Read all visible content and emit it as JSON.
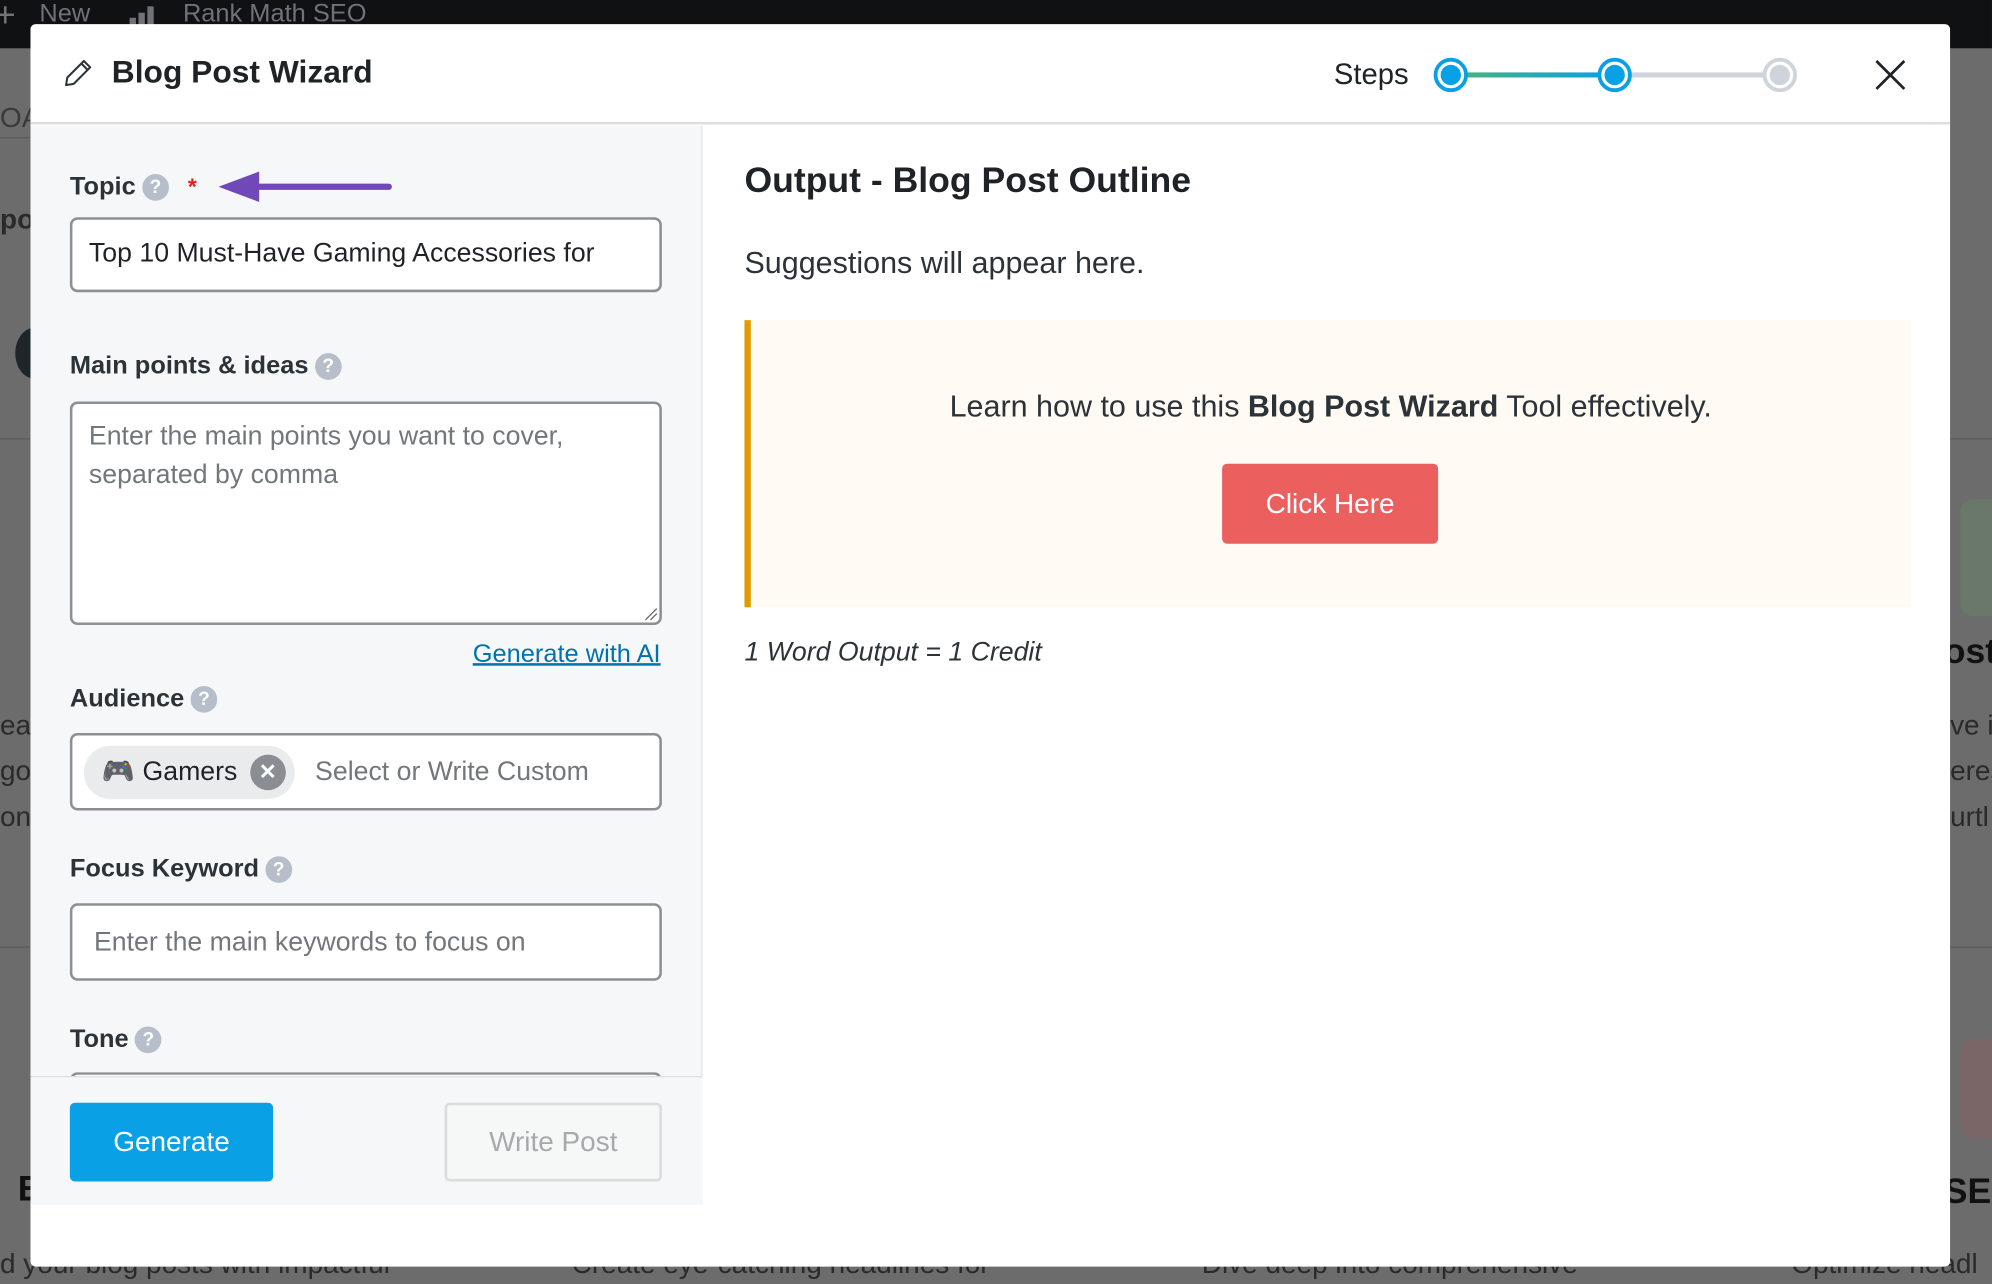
{
  "adminbar": {
    "new_label": "New",
    "plugin_label": "Rank Math SEO"
  },
  "background": {
    "fragments": [
      "OA",
      "po",
      "eat",
      "go.",
      "ont",
      "E",
      "d your blog posts with impactful",
      "Create eye-catching headlines for",
      "Dive deep into comprehensive",
      "Optimize headl",
      "ost",
      "ve i",
      "eres",
      "urtl",
      "SEO"
    ]
  },
  "modal": {
    "title": "Blog Post Wizard",
    "steps_label": "Steps",
    "steps": {
      "total": 3,
      "current": 2
    },
    "colors": {
      "accent": "#0aa0e6",
      "step_inactive": "#cfd4da",
      "button_danger": "#ec5f5f",
      "notice_border": "#e09b00",
      "arrow": "#7048b8"
    }
  },
  "form": {
    "topic": {
      "label": "Topic",
      "required_mark": "*",
      "value": "Top 10 Must-Have Gaming Accessories for"
    },
    "main_points": {
      "label": "Main points & ideas",
      "placeholder": "Enter the main points you want to cover, separated by comma",
      "generate_link": "Generate with AI"
    },
    "audience": {
      "label": "Audience",
      "chips": [
        {
          "emoji": "🎮",
          "label": "Gamers"
        }
      ],
      "placeholder": "Select or Write Custom"
    },
    "focus_keyword": {
      "label": "Focus Keyword",
      "placeholder": "Enter the main keywords to focus on"
    },
    "tone": {
      "label": "Tone"
    },
    "help_glyph": "?",
    "generate_label": "Generate",
    "write_post_label": "Write Post"
  },
  "output": {
    "title": "Output - Blog Post Outline",
    "suggestions": "Suggestions will appear here.",
    "notice": {
      "prefix": "Learn how to use this ",
      "bold": "Blog Post Wizard",
      "suffix": " Tool effectively.",
      "button": "Click Here"
    },
    "credit_note": "1 Word Output = 1 Credit"
  }
}
